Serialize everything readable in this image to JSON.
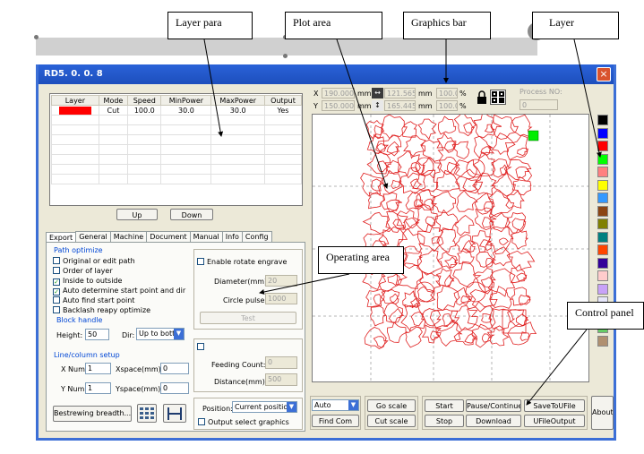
{
  "callouts": {
    "layer_para": "Layer para",
    "plot_area": "Plot area",
    "graphics_bar": "Graphics bar",
    "layer": "Layer",
    "operating_area": "Operating area",
    "control_panel": "Control panel"
  },
  "window": {
    "title": "RD5. 0. 0. 8",
    "close": "×"
  },
  "close_marker": "×",
  "layer_table": {
    "headers": [
      "Layer",
      "Mode",
      "Speed",
      "MinPower",
      "MaxPower",
      "Output"
    ],
    "row": {
      "mode": "Cut",
      "speed": "100.0",
      "min": "30.0",
      "max": "30.0",
      "output": "Yes",
      "color": "#ff0000"
    }
  },
  "buttons": {
    "up": "Up",
    "down": "Down"
  },
  "tabs": [
    "Export",
    "General",
    "Machine",
    "Document",
    "Manual",
    "Info",
    "Config"
  ],
  "path_optimize": {
    "title": "Path optimize",
    "options": [
      {
        "label": "Original or edit path",
        "checked": false
      },
      {
        "label": "Order of layer",
        "checked": false
      },
      {
        "label": "Inside to outside",
        "checked": true
      },
      {
        "label": "Auto determine start point and dir",
        "checked": true
      },
      {
        "label": "Auto find start point",
        "checked": false
      },
      {
        "label": "Backlash reapy optimize",
        "checked": false
      }
    ],
    "block_handle": "Block handle",
    "height_label": "Height:",
    "height_value": "50",
    "dir_label": "Dir:",
    "dir_value": "Up to bott"
  },
  "rotate": {
    "enable_label": "Enable rotate engrave",
    "diameter_label": "Diameter(mm):",
    "diameter_value": "20",
    "pulse_label": "Circle pulse:",
    "pulse_value": "1000",
    "test_label": "Test"
  },
  "feeding": {
    "count_label": "Feeding Count:",
    "count_value": "0",
    "distance_label": "Distance(mm):",
    "distance_value": "500"
  },
  "line_column": {
    "title": "Line/column setup",
    "xnum_label": "X Num:",
    "xnum_value": "1",
    "xspace_label": "Xspace(mm):",
    "xspace_value": "0",
    "ynum_label": "Y Num:",
    "ynum_value": "1",
    "yspace_label": "Yspace(mm):",
    "yspace_value": "0",
    "bestrewing": "Bestrewing breadth..."
  },
  "position": {
    "label": "Position:",
    "value": "Current positior",
    "output_select": "Output select graphics"
  },
  "graphics_bar": {
    "x_label": "X",
    "x_value": "190.000",
    "y_label": "Y",
    "y_value": "150.000",
    "unit": "mm",
    "w_value": "121.565",
    "h_value": "165.445",
    "pct1": "100.0",
    "pct2": "100.0",
    "pct": "%",
    "process_label": "Process NO:",
    "process_value": "0"
  },
  "control": {
    "mode_value": "Auto",
    "go_scale": "Go scale",
    "find_com": "Find Com",
    "cut_scale": "Cut scale",
    "start": "Start",
    "pause": "Pause/Continue",
    "save_u": "SaveToUFile",
    "stop": "Stop",
    "download": "Download",
    "ufile_output": "UFileOutput",
    "about": "About"
  },
  "layer_colors": [
    "#000000",
    "#0000ff",
    "#ff0000",
    "#00ff00",
    "#ff8080",
    "#ffff00",
    "#3399ff",
    "#8b4513",
    "#808000",
    "#008080",
    "#ff4500",
    "#330099",
    "#ffcccc",
    "#c8a2f8"
  ],
  "layer_colors_lower": [
    "#e6e6fa",
    "#9999ff",
    "#66cc66",
    "#b09070"
  ]
}
